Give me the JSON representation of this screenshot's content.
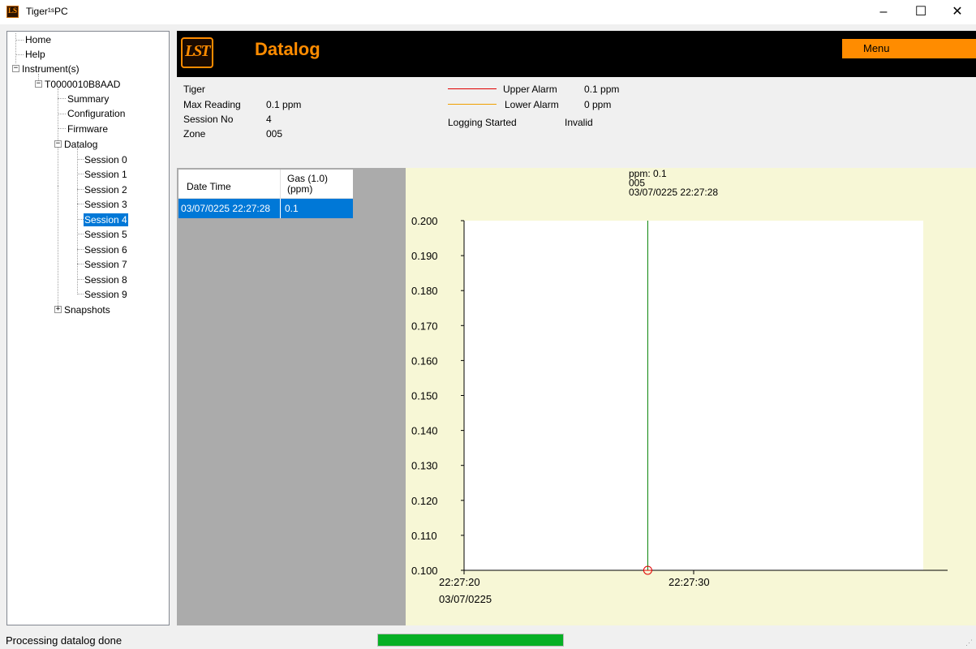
{
  "window": {
    "title": "Tiger¹ˢPC",
    "minimize": "–",
    "maximize": "☐",
    "close": "✕"
  },
  "tree": {
    "home": "Home",
    "help": "Help",
    "instruments": "Instrument(s)",
    "instrument_id": "T0000010B8AAD",
    "summary": "Summary",
    "configuration": "Configuration",
    "firmware": "Firmware",
    "datalog": "Datalog",
    "sessions": [
      "Session 0",
      "Session 1",
      "Session 2",
      "Session 3",
      "Session 4",
      "Session 5",
      "Session 6",
      "Session 7",
      "Session 8",
      "Session 9"
    ],
    "selected_session": "Session 4",
    "snapshots": "Snapshots"
  },
  "header": {
    "logo_text": "LST",
    "title": "Datalog",
    "menu_label": "Menu"
  },
  "info": {
    "instrument_name": "Tiger",
    "max_reading_label": "Max Reading",
    "max_reading_value": "0.1 ppm",
    "session_no_label": "Session No",
    "session_no_value": "4",
    "zone_label": "Zone",
    "zone_value": "005",
    "upper_alarm_label": "Upper Alarm",
    "upper_alarm_value": "0.1 ppm",
    "lower_alarm_label": "Lower Alarm",
    "lower_alarm_value": "0 ppm",
    "logging_started_label": "Logging Started",
    "logging_started_value": "Invalid"
  },
  "grid": {
    "columns": [
      "Date Time",
      "Gas (1.0)\n(ppm)"
    ],
    "col1_header": "Date Time",
    "col2_header_line1": "Gas (1.0)",
    "col2_header_line2": "(ppm)",
    "rows": [
      {
        "datetime": "03/07/0225 22:27:28",
        "gas": "0.1"
      }
    ]
  },
  "colors": {
    "accent": "#ff8c00",
    "upper_alarm": "#e00000",
    "lower_alarm": "#f0a000",
    "selection": "#0078d7",
    "chart_bg": "#f7f7d6",
    "series": "#008000",
    "progress": "#06b025"
  },
  "chart_data": {
    "type": "line",
    "tooltip": [
      "ppm: 0.1",
      "005",
      "03/07/0225 22:27:28"
    ],
    "ylim": [
      0.1,
      0.2
    ],
    "yticks": [
      "0.200",
      "0.190",
      "0.180",
      "0.170",
      "0.160",
      "0.150",
      "0.140",
      "0.130",
      "0.120",
      "0.110",
      "0.100"
    ],
    "xticks": [
      {
        "time": "22:27:20",
        "seconds": 20,
        "date": "03/07/0225"
      },
      {
        "time": "22:27:30",
        "seconds": 30,
        "date": ""
      }
    ],
    "xlim_seconds": [
      20,
      40
    ],
    "series": [
      {
        "x": [
          "22:27:28"
        ],
        "x_seconds": [
          28
        ],
        "values": [
          0.1
        ]
      }
    ]
  },
  "status": {
    "text": "Processing datalog done",
    "progress": 1.0
  }
}
